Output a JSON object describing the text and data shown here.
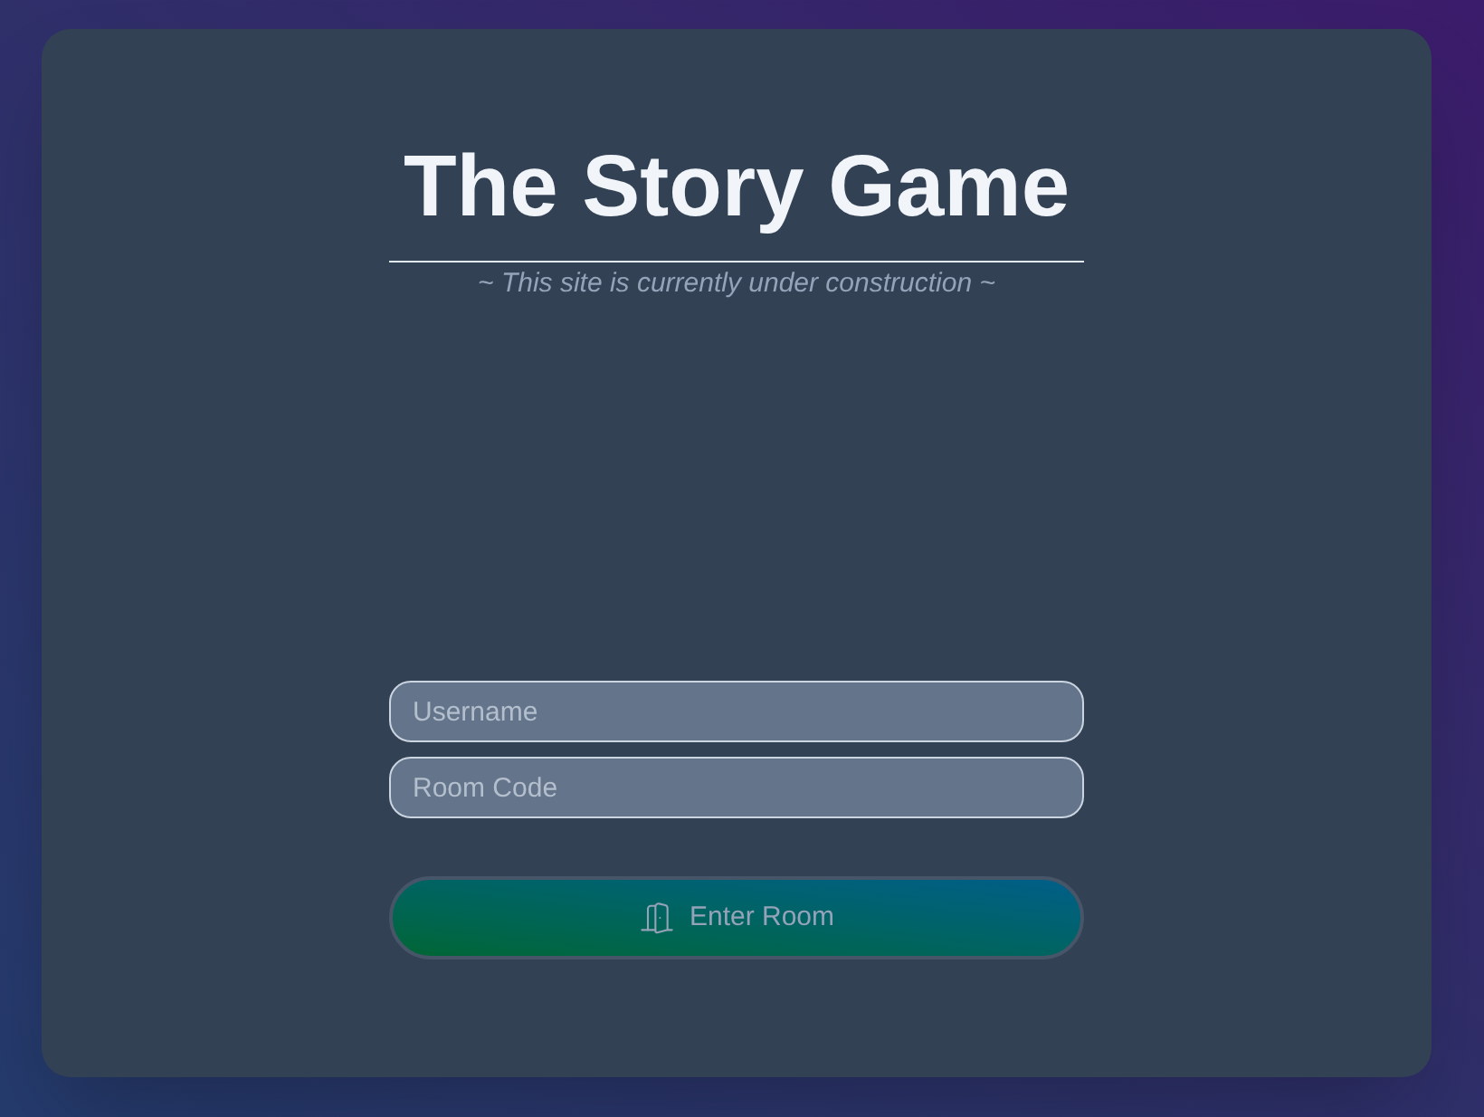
{
  "title": "The Story Game",
  "subtitle": "~ This site is currently under construction ~",
  "fields": [
    {
      "placeholder": "Username"
    },
    {
      "placeholder": "Room Code"
    }
  ],
  "enter_button": {
    "label": "Enter Room",
    "disabled": true
  }
}
